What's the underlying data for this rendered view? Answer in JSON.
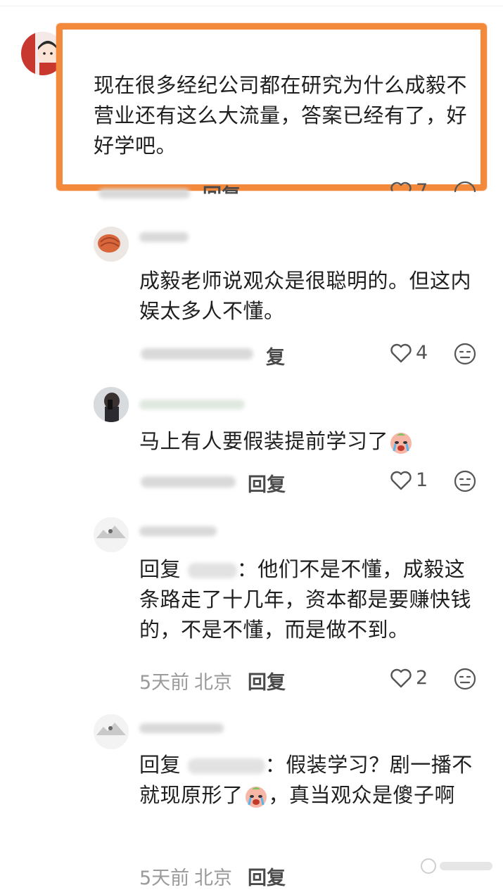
{
  "comments": [
    {
      "text": "现在很多经纪公司都在研究为什么成毅不营业还有这么大流量，答案已经有了，好好学吧。",
      "reply": "回复",
      "likes": "7",
      "highlighted": true
    },
    {
      "text": "成毅老师说观众是很聪明的。但这内娱太多人不懂。",
      "reply": "复",
      "likes": "4"
    },
    {
      "text": "马上有人要假装提前学习了",
      "reply": "回复",
      "likes": "1"
    },
    {
      "prefix": "回复",
      "text": "：他们不是不懂，成毅这条路走了十几年，资本都是要赚快钱的，不是不懂，而是做不到。",
      "time": "5天前",
      "location": "北京",
      "reply": "回复",
      "likes": "2"
    },
    {
      "prefix": "回复",
      "text": "：假装学习？剧一播不就现原形了",
      "text_after": "，真当观众是傻子啊",
      "time": "5天前",
      "location": "北京",
      "reply": "回复"
    }
  ],
  "colors": {
    "highlight": "#f3893b",
    "meta": "#9a9a9a"
  },
  "icons": [
    "heart-outline-icon",
    "emoji-face-icon",
    "crying-emoji-icon"
  ]
}
